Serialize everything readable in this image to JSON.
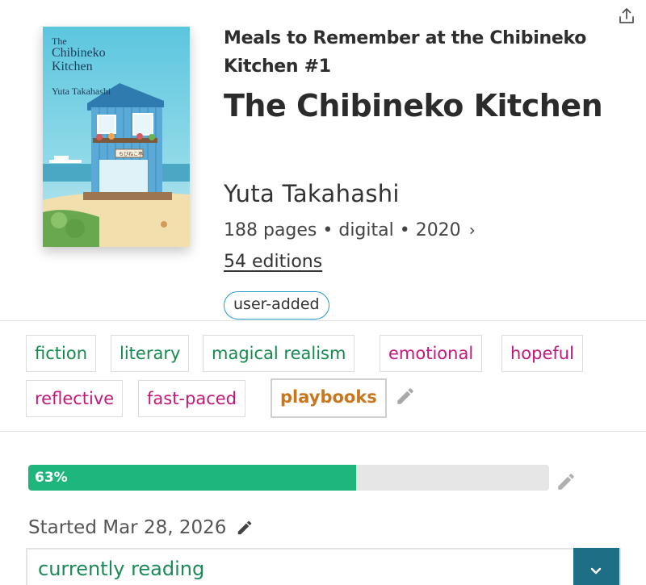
{
  "book": {
    "series": "Meals to Remember at the Chibineko Kitchen #1",
    "title": "The Chibineko Kitchen",
    "author": "Yuta Takahashi",
    "meta": "188 pages • digital • 2020",
    "editions": "54 editions",
    "badge": "user-added",
    "cover": {
      "title_line1": "The",
      "title_line2": "Chibineko",
      "title_line3": "Kitchen",
      "author": "Yuta Takahashi",
      "sign": "ちびねこ亭"
    }
  },
  "tags": [
    {
      "label": "fiction",
      "color": "green"
    },
    {
      "label": "literary",
      "color": "green"
    },
    {
      "label": "magical realism",
      "color": "green"
    },
    {
      "label": "emotional",
      "color": "pink"
    },
    {
      "label": "hopeful",
      "color": "pink"
    },
    {
      "label": "reflective",
      "color": "pink"
    },
    {
      "label": "fast-paced",
      "color": "pink"
    },
    {
      "label": "playbooks",
      "color": "orange"
    }
  ],
  "progress": {
    "percent": 63,
    "label": "63%"
  },
  "started": "Started Mar 28, 2026",
  "status": {
    "value": "currently reading"
  },
  "colors": {
    "accent": "#1fb67e",
    "status_button": "#1e6f86",
    "badge_border": "#2a9bc6"
  },
  "icons": {
    "share": "share-icon",
    "edit": "pencil-icon",
    "dropdown": "chevron-down-icon"
  }
}
